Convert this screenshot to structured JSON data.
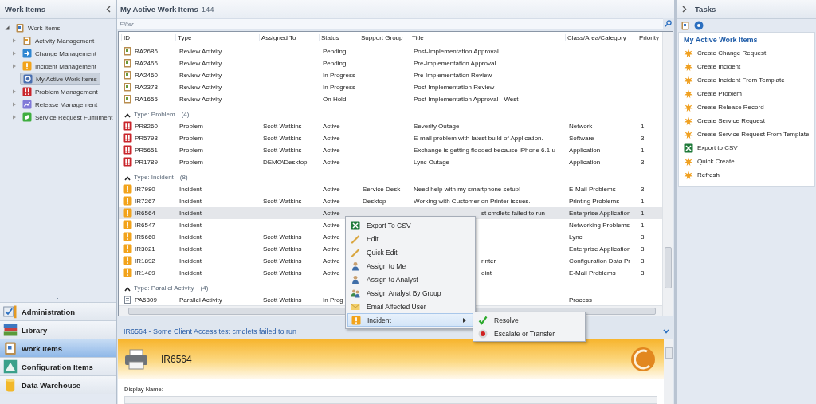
{
  "navigation": {
    "title": "Work Items",
    "tree": {
      "label": "Work Items",
      "kind": "workitems",
      "expanded": true,
      "selected": false,
      "children": [
        {
          "label": "Activity Management",
          "kind": "activity",
          "expanded": false,
          "selected": false
        },
        {
          "label": "Change Management",
          "kind": "change",
          "expanded": false,
          "selected": false
        },
        {
          "label": "Incident Management",
          "kind": "incident",
          "expanded": false,
          "selected": false
        },
        {
          "label": "My Active Work Items",
          "kind": "myitems",
          "selected": true
        },
        {
          "label": "Problem Management",
          "kind": "problem",
          "expanded": false,
          "selected": false
        },
        {
          "label": "Release Management",
          "kind": "release",
          "expanded": false,
          "selected": false
        },
        {
          "label": "Service Request Fulfillment",
          "kind": "service",
          "expanded": false,
          "selected": false
        }
      ]
    },
    "workspaces": [
      {
        "label": "Administration",
        "kind": "admin",
        "selected": false
      },
      {
        "label": "Library",
        "kind": "library",
        "selected": false
      },
      {
        "label": "Work Items",
        "kind": "workitems",
        "selected": true
      },
      {
        "label": "Configuration Items",
        "kind": "config",
        "selected": false
      },
      {
        "label": "Data Warehouse",
        "kind": "warehouse",
        "selected": false
      }
    ]
  },
  "view": {
    "title": "My Active Work Items",
    "count": "144",
    "filter": {
      "placeholder": "Filter"
    },
    "columns": [
      "ID",
      "Type",
      "Assigned To",
      "Status",
      "Support Group",
      "Title",
      "Class/Area/Category",
      "Priority"
    ],
    "groups": [
      {
        "kind": "review",
        "rows": [
          {
            "id": "RA2686",
            "type": "Review Activity",
            "status": "Pending",
            "title": "Post-Implementation Approval",
            "selected": false
          },
          {
            "id": "RA2466",
            "type": "Review Activity",
            "status": "Pending",
            "title": "Pre-Implementation Approval",
            "selected": false
          },
          {
            "id": "RA2460",
            "type": "Review Activity",
            "status": "In Progress",
            "title": "Pre-Implementation Review",
            "selected": false
          },
          {
            "id": "RA2373",
            "type": "Review Activity",
            "status": "In Progress",
            "title": "Post Implementation Review",
            "selected": false
          },
          {
            "id": "RA1655",
            "type": "Review Activity",
            "status": "On Hold",
            "title": "Post Implementation Approval - West",
            "selected": false
          }
        ]
      },
      {
        "kind": "problem",
        "header": "Type: Problem",
        "count": "(4)",
        "expanded": true,
        "rows": [
          {
            "id": "PR8260",
            "type": "Problem",
            "assigned_to": "Scott Watkins",
            "status": "Active",
            "title": "Severity Outage",
            "category": "Network",
            "priority": "1",
            "selected": false
          },
          {
            "id": "PR5793",
            "type": "Problem",
            "assigned_to": "Scott Watkins",
            "status": "Active",
            "title": "E-mail problem with latest build of Application.",
            "category": "Software",
            "priority": "3",
            "selected": false
          },
          {
            "id": "PR5651",
            "type": "Problem",
            "assigned_to": "Scott Watkins",
            "status": "Active",
            "title": "Exchange is getting flooded because iPhone 6.1 u",
            "category": "Application",
            "priority": "1",
            "selected": false
          },
          {
            "id": "PR1789",
            "type": "Problem",
            "assigned_to": "DEMO\\Desktop",
            "status": "Active",
            "title": "Lync Outage",
            "category": "Application",
            "priority": "3",
            "selected": false
          }
        ]
      },
      {
        "kind": "incident",
        "header": "Type: Incident",
        "count": "(8)",
        "expanded": true,
        "rows": [
          {
            "id": "IR7980",
            "type": "Incident",
            "status": "Active",
            "support_group": "Service Desk",
            "title": "Need help with my smartphone setup!",
            "category": "E-Mail Problems",
            "priority": "3",
            "selected": false
          },
          {
            "id": "IR7267",
            "type": "Incident",
            "assigned_to": "Scott Watkins",
            "status": "Active",
            "support_group": "Desktop",
            "title": "Working with Customer on Printer issues.",
            "category": "Printing Problems",
            "priority": "1",
            "selected": false
          },
          {
            "id": "IR6564",
            "type": "Incident",
            "status": "Active",
            "title": "st cmdlets failed to run",
            "title_covered": true,
            "category": "Enterprise Application",
            "priority": "1",
            "selected": true
          },
          {
            "id": "IR6547",
            "type": "Incident",
            "status": "Active",
            "category": "Networking Problems",
            "priority": "1",
            "selected": false
          },
          {
            "id": "IR5660",
            "type": "Incident",
            "assigned_to": "Scott Watkins",
            "status": "Active",
            "category": "Lync",
            "priority": "3",
            "selected": false
          },
          {
            "id": "IR3021",
            "type": "Incident",
            "assigned_to": "Scott Watkins",
            "status": "Active",
            "category": "Enterprise Application",
            "priority": "3",
            "selected": false
          },
          {
            "id": "IR1892",
            "type": "Incident",
            "assigned_to": "Scott Watkins",
            "status": "Active",
            "title": "rinter",
            "title_covered": true,
            "category": "Configuration Data Pr",
            "priority": "3",
            "selected": false
          },
          {
            "id": "IR1489",
            "type": "Incident",
            "assigned_to": "Scott Watkins",
            "status": "Active",
            "title": "oint",
            "title_covered": true,
            "category": "E-Mail Problems",
            "priority": "3",
            "selected": false
          }
        ]
      },
      {
        "kind": "parallel",
        "header": "Type: Parallel Activity",
        "count": "(4)",
        "expanded": true,
        "rows": [
          {
            "id": "PA5309",
            "type": "Parallel Activity",
            "assigned_to": "Scott Watkins",
            "status": "In Prog",
            "category": "Process",
            "selected": false
          }
        ]
      }
    ],
    "context_menu": [
      {
        "label": "Export To CSV",
        "kind": "excel",
        "selected": false
      },
      {
        "label": "Edit",
        "kind": "pencil",
        "selected": false
      },
      {
        "label": "Quick Edit",
        "kind": "pencil",
        "selected": false
      },
      {
        "label": "Assign to Me",
        "kind": "person",
        "selected": false
      },
      {
        "label": "Assign to Analyst",
        "kind": "person",
        "selected": false
      },
      {
        "label": "Assign Analyst By Group",
        "kind": "people",
        "selected": false
      },
      {
        "label": "Email Affected User",
        "kind": "envelope",
        "selected": false
      },
      {
        "label": "Incident",
        "kind": "incident",
        "submenu": true,
        "selected": true
      }
    ],
    "submenu": [
      {
        "label": "Resolve",
        "kind": "check"
      },
      {
        "label": "Escalate or Transfer",
        "kind": "escalate"
      }
    ],
    "preview": {
      "header": "IR6564 - Some Client Access test cmdlets failed to run",
      "id": "IR6564",
      "field_label": "Display Name:"
    }
  },
  "tasks": {
    "title": "Tasks",
    "section": "My Active Work Items",
    "items": [
      {
        "label": "Create Change Request",
        "kind": "star"
      },
      {
        "label": "Create Incident",
        "kind": "star"
      },
      {
        "label": "Create Incident From Template",
        "kind": "star"
      },
      {
        "label": "Create Problem",
        "kind": "star"
      },
      {
        "label": "Create Release Record",
        "kind": "star"
      },
      {
        "label": "Create Service Request",
        "kind": "star"
      },
      {
        "label": "Create Service Request From Template",
        "kind": "star"
      },
      {
        "label": "Export to CSV",
        "kind": "excel"
      },
      {
        "label": "Quick Create",
        "kind": "star"
      },
      {
        "label": "Refresh",
        "kind": "star"
      }
    ]
  }
}
